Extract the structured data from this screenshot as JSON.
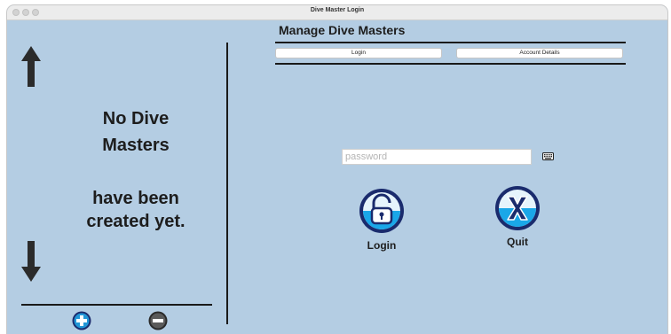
{
  "window": {
    "title": "Dive Master Login"
  },
  "sidebar": {
    "empty_line1": "No Dive",
    "empty_line2": "Masters",
    "empty_line3": "have been",
    "empty_line4": "created yet.",
    "icons": [
      "arrow-up-icon",
      "arrow-down-icon",
      "plus-circle-icon",
      "minus-circle-icon"
    ]
  },
  "main": {
    "heading": "Manage Dive Masters",
    "tabs": [
      {
        "label": "Login"
      },
      {
        "label": "Account Details"
      }
    ],
    "password": {
      "value": "",
      "placeholder": "password"
    },
    "actions": {
      "login_label": "Login",
      "quit_label": "Quit"
    }
  },
  "colors": {
    "background": "#b4cde3",
    "icon_blue": "#2196d6",
    "icon_dark": "#1a2b6d",
    "minus_gray": "#4a4a4a"
  }
}
